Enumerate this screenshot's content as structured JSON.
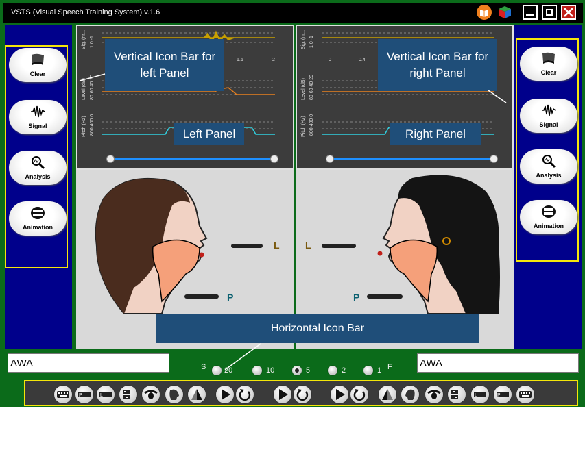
{
  "window": {
    "title": "VSTS (Visual Speech Training System) v.1.6"
  },
  "left_bar": {
    "buttons": [
      "Clear",
      "Signal",
      "Analysis",
      "Animation"
    ]
  },
  "right_bar": {
    "buttons": [
      "Clear",
      "Signal",
      "Analysis",
      "Animation"
    ]
  },
  "left_panel": {
    "graphs": [
      {
        "ylabel": "Sig. (nr...",
        "scale": "1 0 -1"
      },
      {
        "ylabel": "Level (dB)",
        "scale": "80 60 40 20"
      },
      {
        "ylabel": "Pitch (Hz)",
        "scale": "800 400 0"
      }
    ],
    "xticks": [
      "1.6",
      "2"
    ],
    "letters": {
      "L": "L",
      "P": "P"
    }
  },
  "right_panel": {
    "graphs": [
      {
        "ylabel": "Sig. (nr...",
        "scale": "1 0 -1"
      },
      {
        "ylabel": "Level (dB)",
        "scale": "80 60 40 20"
      },
      {
        "ylabel": "Pitch (Hz)",
        "scale": "800 400 0"
      }
    ],
    "xticks": [
      "0",
      "0.4"
    ],
    "letters": {
      "L": "L",
      "P": "P"
    }
  },
  "callouts": {
    "left_icon_bar": "Vertical Icon Bar for left Panel",
    "right_icon_bar": "Vertical Icon Bar for right Panel",
    "left_panel": "Left Panel",
    "right_panel": "Right Panel",
    "horizontal_bar": "Horizontal Icon Bar"
  },
  "inputs": {
    "left_text": "AWA",
    "right_text": "AWA"
  },
  "speed": {
    "start_label": "S",
    "end_label": "F",
    "options": [
      "20",
      "10",
      "5",
      "2",
      "1"
    ],
    "selected": "5"
  },
  "colors": {
    "app_bg": "#0b6b1a",
    "side_bg": "#00008b",
    "callout": "#1f4e79",
    "highlight": "#f5e60a",
    "signal": "#c8a000",
    "level": "#e8801e",
    "pitch": "#30d0e0"
  },
  "horizontal_bar_icons": [
    "keyboard-icon",
    "scale-p-icon",
    "scale-l-icon",
    "toggle-lf-icon",
    "eye-profile-icon",
    "head-profile-icon",
    "triangle-icon",
    "play-icon",
    "replay-icon",
    "play-icon",
    "replay-icon",
    "play-icon",
    "replay-icon",
    "triangle-icon",
    "head-profile-icon",
    "eye-profile-icon",
    "toggle-lf-icon",
    "scale-l-icon",
    "scale-p-icon",
    "keyboard-icon"
  ]
}
